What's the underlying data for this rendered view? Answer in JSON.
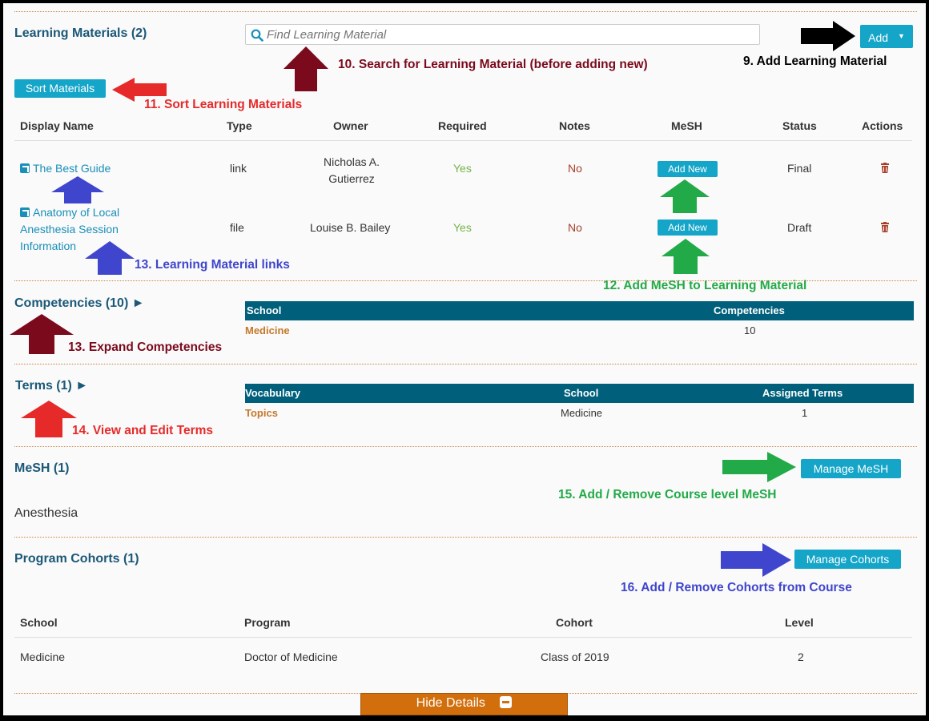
{
  "learning_materials": {
    "title": "Learning Materials (2)",
    "search_placeholder": "Find Learning Material",
    "add_label": "Add",
    "sort_label": "Sort Materials",
    "columns": [
      "Display Name",
      "Type",
      "Owner",
      "Required",
      "Notes",
      "MeSH",
      "Status",
      "Actions"
    ],
    "rows": [
      {
        "name": "The Best Guide",
        "type": "link",
        "owner_line1": "Nicholas A.",
        "owner_line2": "Gutierrez",
        "required": "Yes",
        "notes": "No",
        "mesh_button": "Add New",
        "status": "Final"
      },
      {
        "name_line1": "Anatomy of Local",
        "name_line2": "Anesthesia Session",
        "name_line3": "Information",
        "type": "file",
        "owner": "Louise B. Bailey",
        "required": "Yes",
        "notes": "No",
        "mesh_button": "Add New",
        "status": "Draft"
      }
    ]
  },
  "competencies": {
    "title": "Competencies (10) ►",
    "columns": [
      "School",
      "Competencies"
    ],
    "row": {
      "school": "Medicine",
      "count": "10"
    }
  },
  "terms": {
    "title": "Terms (1) ►",
    "columns": [
      "Vocabulary",
      "School",
      "Assigned Terms"
    ],
    "row": {
      "vocabulary": "Topics",
      "school": "Medicine",
      "assigned": "1"
    }
  },
  "mesh": {
    "title": "MeSH (1)",
    "manage_label": "Manage MeSH",
    "term": "Anesthesia"
  },
  "cohorts": {
    "title": "Program Cohorts (1)",
    "manage_label": "Manage Cohorts",
    "columns": [
      "School",
      "Program",
      "Cohort",
      "Level"
    ],
    "row": {
      "school": "Medicine",
      "program": "Doctor of Medicine",
      "cohort": "Class of 2019",
      "level": "2"
    }
  },
  "hide_details_label": "Hide Details",
  "annotations": {
    "a9": "9. Add Learning Material",
    "a10": "10. Search for Learning Material (before adding new)",
    "a11": "11. Sort Learning Materials",
    "a12": "12. Add MeSH to Learning Material",
    "a13_links": "13. Learning Material links",
    "a13_expand": "13. Expand Competencies",
    "a14": "14. View and Edit Terms",
    "a15": "15. Add / Remove Course level MeSH",
    "a16": "16. Add / Remove Cohorts from Course"
  },
  "colors": {
    "accent": "#14a5c8",
    "table_header": "#00607c",
    "section_title": "#1b5878",
    "hide_details": "#d26f0c",
    "arrow_black": "#000000",
    "arrow_maroon": "#7a0a1c",
    "arrow_red": "#e62a2a",
    "arrow_blue": "#3f45cc",
    "arrow_green": "#22aa48"
  },
  "icons": [
    "search-icon",
    "external-link-icon",
    "trash-icon",
    "caret-down-icon",
    "minus-icon"
  ]
}
